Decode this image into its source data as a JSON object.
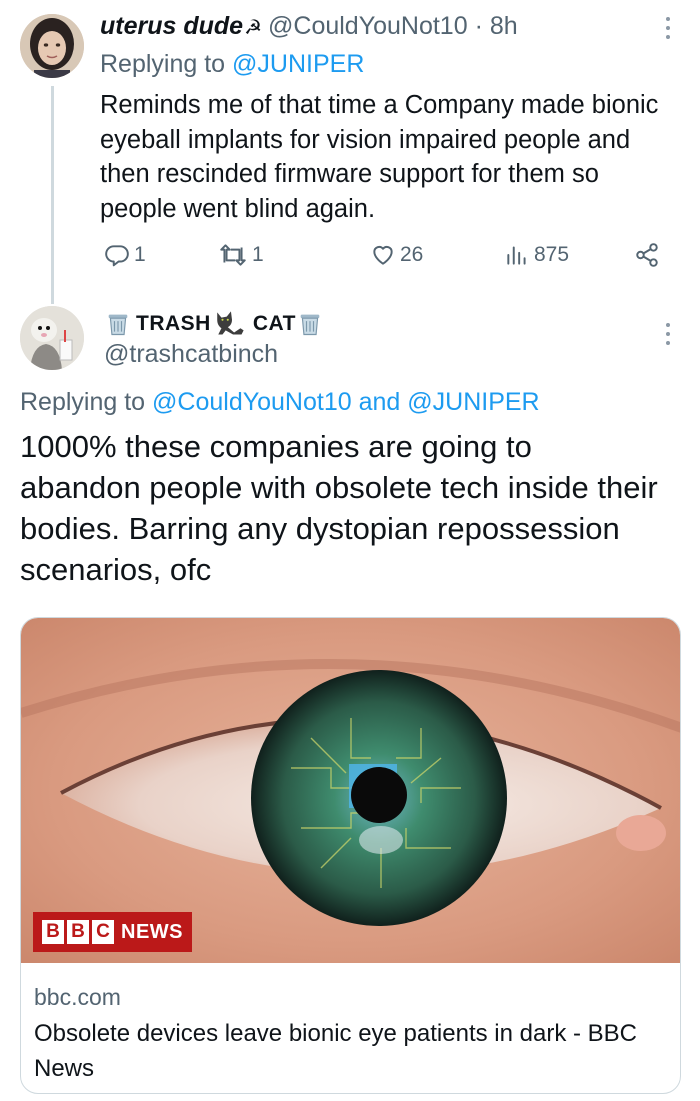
{
  "tweet1": {
    "name": "uterus dude",
    "emoji": "☭",
    "handle": "@CouldYouNot10",
    "separator": "·",
    "time": "8h",
    "replying_prefix": "Replying to",
    "replying_mention": "@JUNIPER",
    "body": "Reminds me of that time a Company made bionic eyeball implants for vision impaired people and then rescinded firmware support for them so people went blind again.",
    "actions": {
      "replies": "1",
      "retweets": "1",
      "likes": "26",
      "views": "875"
    }
  },
  "tweet2": {
    "name_part1": "TRASH",
    "name_part2": "CAT",
    "handle": "@trashcatbinch",
    "replying_prefix": "Replying to",
    "replying_mention1": "@CouldYouNot10",
    "replying_and": "and",
    "replying_mention2": "@JUNIPER",
    "body": "1000% these companies are going to abandon people with obsolete tech inside their bodies. Barring any dystopian repossession scenarios, ofc"
  },
  "card": {
    "badge_letters": [
      "B",
      "B",
      "C"
    ],
    "badge_word": "NEWS",
    "domain": "bbc.com",
    "title": "Obsolete devices leave bionic eye patients in dark - BBC News"
  },
  "colors": {
    "link": "#1d9bf0",
    "secondary_text": "#536471",
    "bbc_red": "#bb1919"
  },
  "icons": [
    "more-icon",
    "reply-icon",
    "retweet-icon",
    "like-icon",
    "views-icon",
    "share-icon",
    "trash-can-icon",
    "cat-icon"
  ]
}
